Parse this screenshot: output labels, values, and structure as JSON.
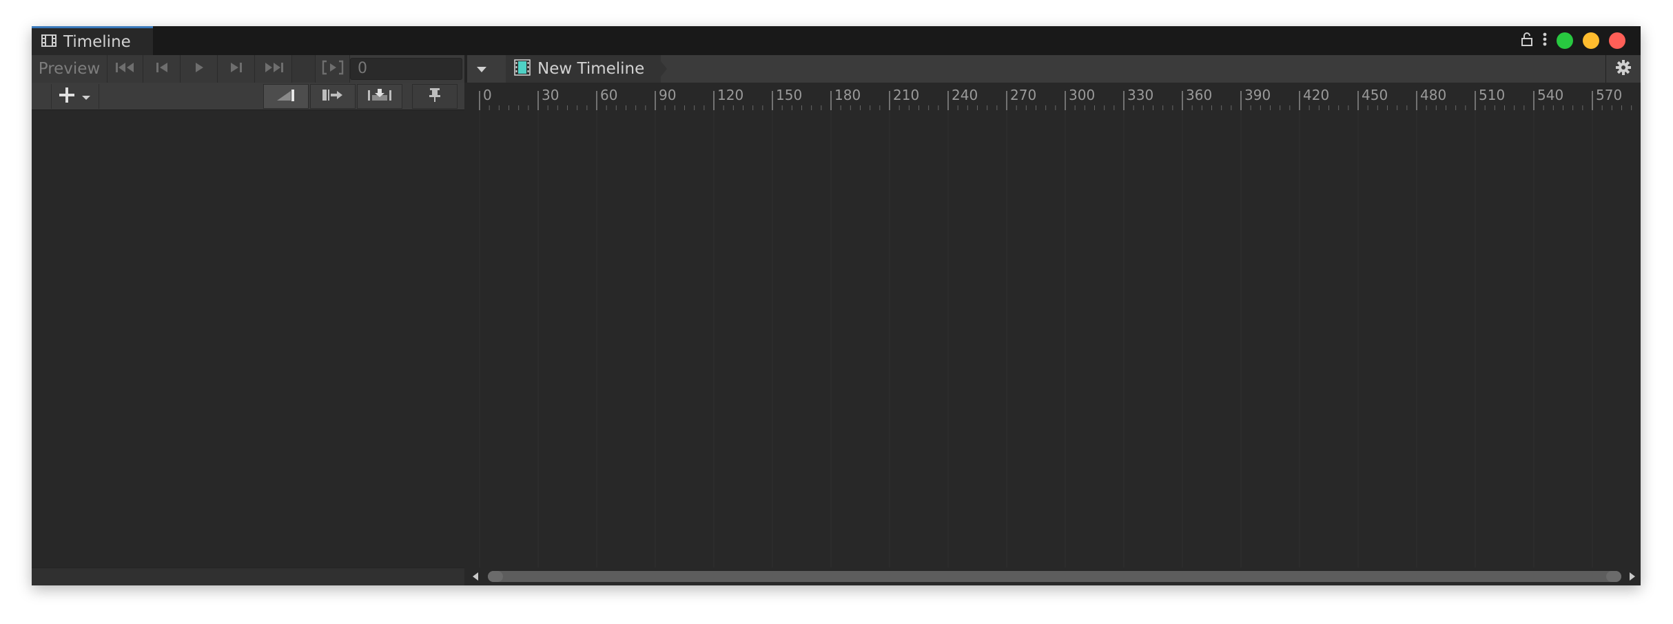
{
  "window": {
    "tab_title": "Timeline",
    "tab_icon": "film-strip-icon",
    "controls": {
      "close_color": "#ff5f57",
      "minimize_color": "#febc2e",
      "maximize_color": "#28c840"
    }
  },
  "toolbar": {
    "preview_label": "Preview",
    "frame_value": "0",
    "timeline_name": "New Timeline",
    "buttons": [
      "go-to-start",
      "previous-frame",
      "play",
      "next-frame",
      "go-to-end",
      "play-range"
    ]
  },
  "track_toolbar": {
    "add_label": "+",
    "buttons": [
      "edit-mode",
      "ripple-mode",
      "replace-mode",
      "pin"
    ]
  },
  "ruler": {
    "ticks": [
      "0",
      "30",
      "60",
      "90",
      "120",
      "150",
      "180",
      "210",
      "240",
      "270",
      "300",
      "330",
      "360",
      "390",
      "420",
      "450",
      "480",
      "510",
      "540",
      "570"
    ]
  },
  "colors": {
    "accent": "#3a79bb",
    "background": "#282828",
    "toolbar": "#3b3b3b"
  }
}
